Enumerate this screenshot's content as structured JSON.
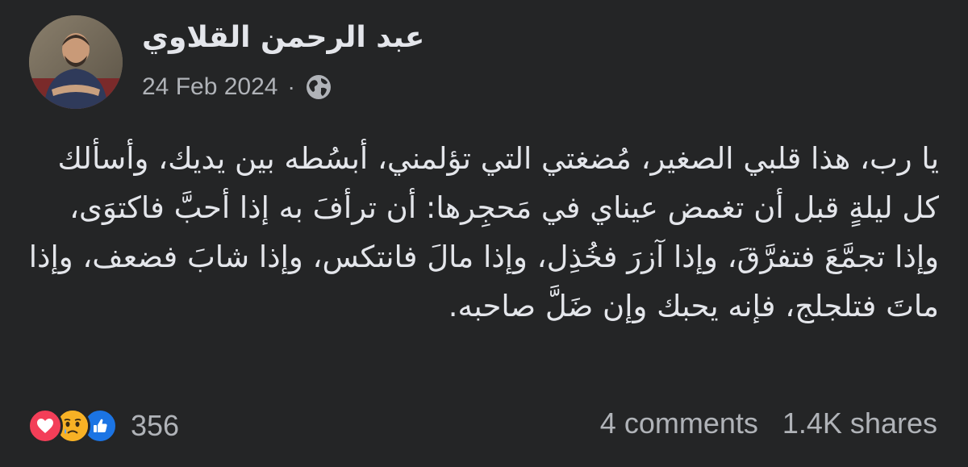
{
  "author": {
    "name": "عبد الرحمن القلاوي"
  },
  "meta": {
    "date": "24 Feb 2024",
    "separator": "·",
    "privacy_icon": "globe-icon"
  },
  "post": {
    "text": "يا رب، هذا قلبي الصغير، مُضغتي التي تؤلمني، أبسُطه بين يديك، وأسألك كل ليلةٍ قبل أن تغمض عيناي في مَحجِرها: أن ترأفَ به إذا أحبَّ فاكتوَى، وإذا تجمَّعَ فتفرَّقَ، وإذا آزرَ فخُذِل، وإذا مالَ فانتكس، وإذا شابَ فضعف، وإذا ماتَ فتلجلج، فإنه يحبك وإن ضَلَّ صاحبه."
  },
  "reactions": {
    "icons": [
      "love-icon",
      "sad-icon",
      "like-icon"
    ],
    "count": "356",
    "colors": {
      "love": "#f33e58",
      "sad": "#f7b125",
      "like": "#1b74e4"
    }
  },
  "stats": {
    "comments": "4 comments",
    "shares": "1.4K shares"
  },
  "theme": {
    "background": "#242526",
    "text_primary": "#e4e6eb",
    "text_secondary": "#b0b3b8"
  }
}
